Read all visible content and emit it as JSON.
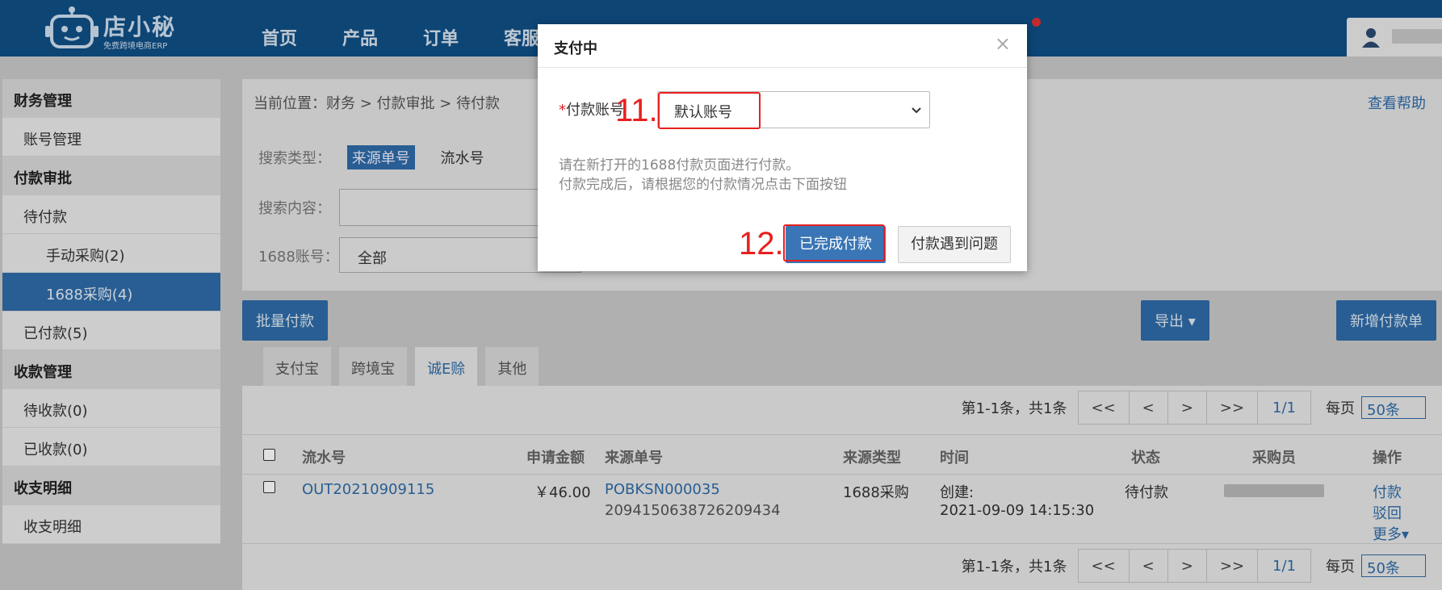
{
  "topbar": {
    "logo_title": "店小秘",
    "logo_sub": "免费跨境电商ERP",
    "nav": [
      "首页",
      "产品",
      "订单",
      "客服"
    ]
  },
  "sidebar": {
    "items": [
      {
        "label": "财务管理",
        "kind": "group"
      },
      {
        "label": "账号管理",
        "kind": "item"
      },
      {
        "label": "付款审批",
        "kind": "group"
      },
      {
        "label": "待付款",
        "kind": "item"
      },
      {
        "label": "手动采购(2)",
        "kind": "sub"
      },
      {
        "label": "1688采购(4)",
        "kind": "sub-active"
      },
      {
        "label": "已付款(5)",
        "kind": "item"
      },
      {
        "label": "收款管理",
        "kind": "group"
      },
      {
        "label": "待收款(0)",
        "kind": "item"
      },
      {
        "label": "已收款(0)",
        "kind": "item"
      },
      {
        "label": "收支明细",
        "kind": "group"
      },
      {
        "label": "收支明细",
        "kind": "item"
      }
    ]
  },
  "main": {
    "breadcrumb": "当前位置：财务 > 付款审批 > 待付款",
    "help": "查看帮助",
    "search_type_label": "搜索类型：",
    "search_type_options": [
      "来源单号",
      "流水号"
    ],
    "search_content_label": "搜索内容：",
    "account_label": "1688账号：",
    "account_value": "全部",
    "batch_pay": "批量付款",
    "export": "导出 ▾",
    "new_payment": "新增付款单",
    "tabs": [
      "支付宝",
      "跨境宝",
      "诚E赊",
      "其他"
    ],
    "active_tab": "诚E赊"
  },
  "pager": {
    "summary": "第1-1条，共1条",
    "first": "<<",
    "prev": "<",
    "next": ">",
    "last": ">>",
    "current": "1/1",
    "per_page_label": "每页",
    "per_page_value": "50条"
  },
  "table": {
    "headers": {
      "serial": "流水号",
      "amount": "申请金额",
      "source": "来源单号",
      "source_type": "来源类型",
      "time": "时间",
      "status": "状态",
      "buyer": "采购员",
      "actions": "操作"
    },
    "row": {
      "serial": "OUT20210909115",
      "amount": "￥46.00",
      "source_no": "POBKSN000035",
      "source_no2": "2094150638726209434",
      "source_type": "1688采购",
      "time_label": "创建:",
      "time_value": "2021-09-09 14:15:30",
      "status": "待付款",
      "action_pay": "付款",
      "action_reject": "驳回",
      "action_more": "更多▾"
    }
  },
  "modal": {
    "title": "支付中",
    "close": "×",
    "field_required_mark": "*",
    "field_label": "付款账号",
    "field_value": "默认账号",
    "note_line1": "请在新打开的1688付款页面进行付款。",
    "note_line2": "付款完成后，请根据您的付款情况点击下面按钮",
    "btn_done": "已完成付款",
    "btn_problem": "付款遇到问题"
  },
  "annotations": {
    "step11": "11.",
    "step12": "12.",
    "color": "#e8201f"
  }
}
